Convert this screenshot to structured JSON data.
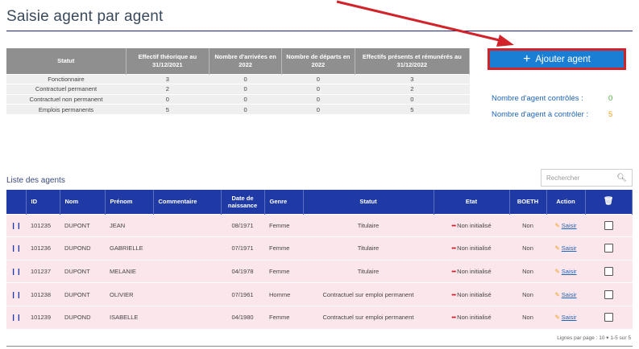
{
  "page": {
    "title": "Saisie agent par agent"
  },
  "summary": {
    "headers": [
      "Statut",
      "Effectif théorique au 31/12/2021",
      "Nombre d'arrivées en 2022",
      "Nombre de départs en 2022",
      "Effectifs présents et rémunérés au 31/12/2022"
    ],
    "rows": [
      {
        "statut": "Fonctionnaire",
        "theorique": "3",
        "arrivees": "0",
        "departs": "0",
        "presents": "3"
      },
      {
        "statut": "Contractuel permanent",
        "theorique": "2",
        "arrivees": "0",
        "departs": "0",
        "presents": "2"
      },
      {
        "statut": "Contractuel non permanent",
        "theorique": "0",
        "arrivees": "0",
        "departs": "0",
        "presents": "0"
      },
      {
        "statut": "Emplois permanents",
        "theorique": "5",
        "arrivees": "0",
        "departs": "0",
        "presents": "5"
      }
    ]
  },
  "actions": {
    "add_agent_label": "Ajouter agent"
  },
  "controls": {
    "controlled_label": "Nombre d'agent contrôlés :",
    "controlled_count": "0",
    "to_control_label": "Nombre d'agent à contrôler :",
    "to_control_count": "5"
  },
  "list": {
    "title": "Liste des agents",
    "search_placeholder": "Rechercher",
    "headers": {
      "id": "ID",
      "nom": "Nom",
      "prenom": "Prénom",
      "commentaire": "Commentaire",
      "naissance_1": "Date de",
      "naissance_2": "naissance",
      "genre": "Genre",
      "statut": "Statut",
      "etat": "Etat",
      "boeth": "BOETH",
      "action": "Action"
    },
    "rows": [
      {
        "id": "101235",
        "nom": "DUPONT",
        "prenom": "JEAN",
        "commentaire": "",
        "naissance": "08/1971",
        "genre": "Femme",
        "statut": "Titulaire",
        "etat": "Non initialisé",
        "boeth": "Non",
        "action": "Saisir"
      },
      {
        "id": "101236",
        "nom": "DUPOND",
        "prenom": "GABRIELLE",
        "commentaire": "",
        "naissance": "07/1971",
        "genre": "Femme",
        "statut": "Titulaire",
        "etat": "Non initialisé",
        "boeth": "Non",
        "action": "Saisir"
      },
      {
        "id": "101237",
        "nom": "DUPONT",
        "prenom": "MELANIE",
        "commentaire": "",
        "naissance": "04/1978",
        "genre": "Femme",
        "statut": "Titulaire",
        "etat": "Non initialisé",
        "boeth": "Non",
        "action": "Saisir"
      },
      {
        "id": "101238",
        "nom": "DUPONT",
        "prenom": "OLIVIER",
        "commentaire": "",
        "naissance": "07/1961",
        "genre": "Homme",
        "statut": "Contractuel sur emploi permanent",
        "etat": "Non initialisé",
        "boeth": "Non",
        "action": "Saisir"
      },
      {
        "id": "101239",
        "nom": "DUPOND",
        "prenom": "ISABELLE",
        "commentaire": "",
        "naissance": "04/1980",
        "genre": "Femme",
        "statut": "Contractuel sur emploi permanent",
        "etat": "Non initialisé",
        "boeth": "Non",
        "action": "Saisir"
      }
    ],
    "pager": "Lignes par page : 10  ▾   1-5 sur 5"
  },
  "colors": {
    "accent": "#1f3aa5",
    "button": "#1a7fd4",
    "highlight": "#d2232a",
    "row_bg": "#fbe6ec"
  }
}
